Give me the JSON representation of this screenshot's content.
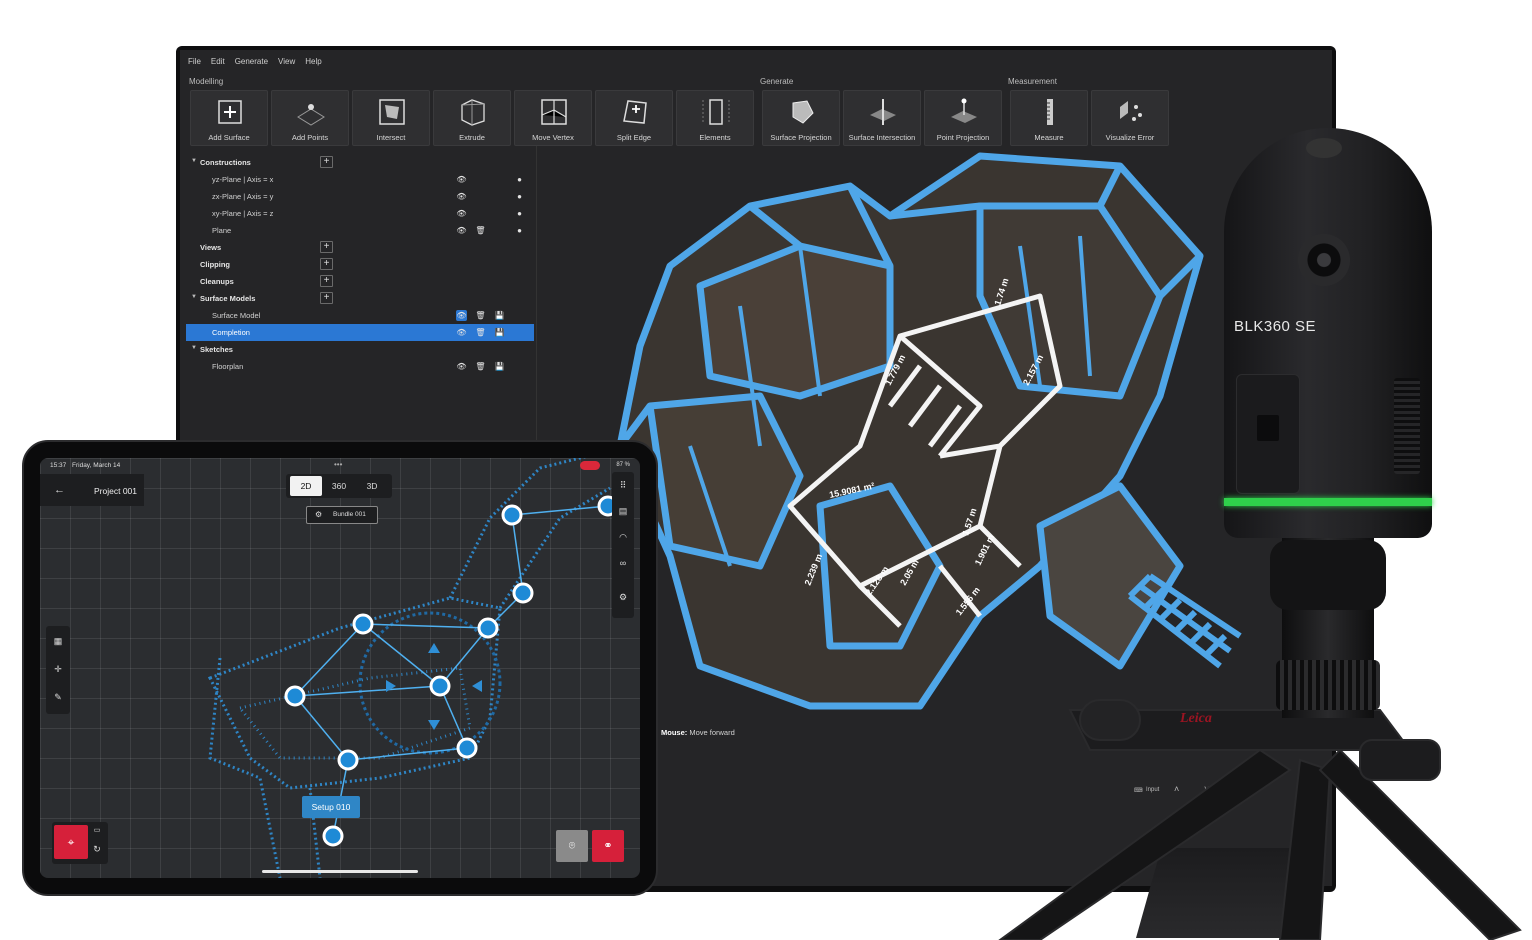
{
  "colors": {
    "accent_blue": "#2b78d4",
    "tablet_red": "#d6203a",
    "scanner_green": "#2fd04b",
    "wireframe_blue": "#4fa6e8"
  },
  "menu": [
    "File",
    "Edit",
    "Generate",
    "View",
    "Help"
  ],
  "ribbon": {
    "groups": {
      "modelling": "Modelling",
      "generate": "Generate",
      "measurement": "Measurement"
    },
    "tools": {
      "add_surface": "Add Surface",
      "add_points": "Add Points",
      "intersect": "Intersect",
      "extrude": "Extrude",
      "move_vertex": "Move Vertex",
      "split_edge": "Split Edge",
      "elements": "Elements",
      "surface_projection": "Surface Projection",
      "surface_intersection": "Surface Intersection",
      "point_projection": "Point Projection",
      "measure": "Measure",
      "visualize_error": "Visualize Error"
    }
  },
  "tree": {
    "constructions": "Constructions",
    "yz": "yz-Plane | Axis = x",
    "zx": "zx-Plane | Axis = y",
    "xy": "xy-Plane | Axis = z",
    "plane": "Plane",
    "views": "Views",
    "clipping": "Clipping",
    "cleanups": "Cleanups",
    "surface_models": "Surface Models",
    "surface_model": "Surface Model",
    "completion": "Completion",
    "sketches": "Sketches",
    "floorplan": "Floorplan"
  },
  "viewport": {
    "hint_key": "Mouse:",
    "hint_text": "Move forward",
    "measurements": [
      "1.779 m",
      "2.157 m",
      "15.9081 m²",
      "2.239 m",
      "2.128 m",
      "2.05 m",
      "1.57 m",
      "1.901 m",
      "1.556 m",
      "1.74 m"
    ]
  },
  "statusbar": {
    "input_label": "Input"
  },
  "tablet": {
    "time": "15:37",
    "date": "Friday, March 14",
    "battery": "87 %",
    "project": "Project 001",
    "modes": [
      "2D",
      "360",
      "3D"
    ],
    "bundle": "Bundle 001",
    "setup": "Setup 010"
  },
  "scanner": {
    "model": "BLK360 SE",
    "brand_mark": "Leica"
  }
}
